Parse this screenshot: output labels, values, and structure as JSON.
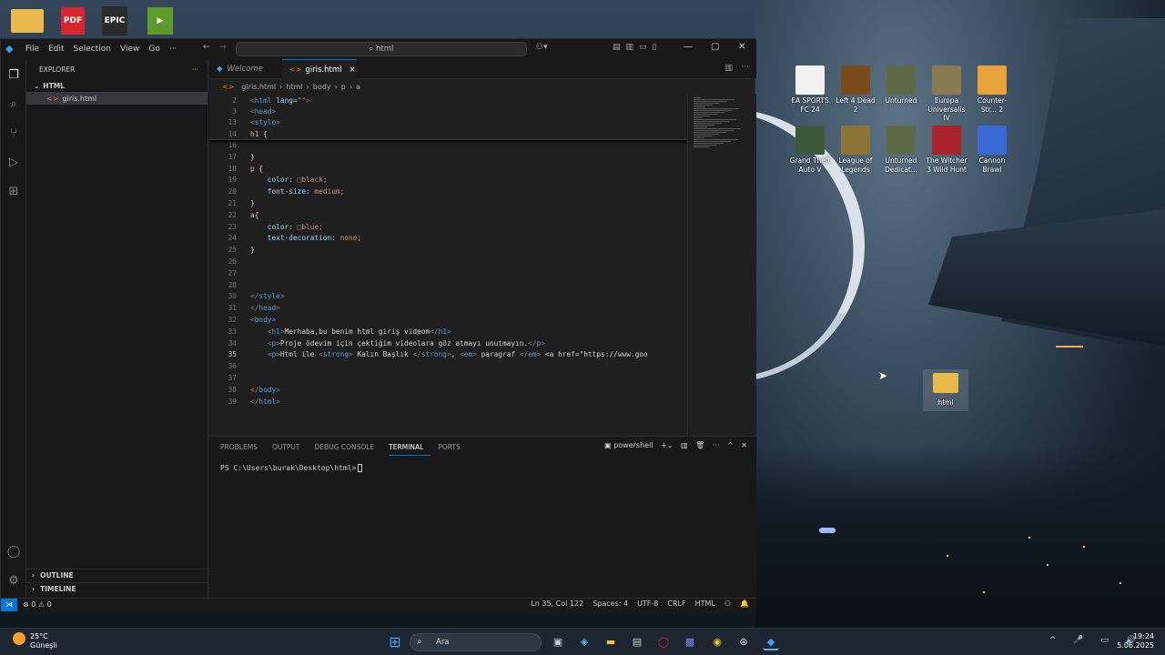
{
  "desktop_top_icons": [
    {
      "label": "",
      "glyph": "",
      "color": "#e9b949"
    },
    {
      "label": "PDF",
      "glyph": "PDF",
      "color": "#d7262e"
    },
    {
      "label": "EPIC",
      "glyph": "EPIC",
      "color": "#2a2a2a"
    },
    {
      "label": "",
      "glyph": "▶",
      "color": "#5f9b2a"
    }
  ],
  "window": {
    "menu": [
      "File",
      "Edit",
      "Selection",
      "View",
      "Go",
      "···"
    ],
    "search": "html",
    "controls": [
      "—",
      "▢",
      "✕"
    ]
  },
  "explorer": {
    "title": "EXPLORER",
    "more": "···",
    "folder": "HTML",
    "file": "giris.html",
    "outline": "OUTLINE",
    "timeline": "TIMELINE"
  },
  "tabs": [
    {
      "label": "Welcome",
      "active": false
    },
    {
      "label": "giris.html",
      "active": true,
      "close": "×"
    }
  ],
  "breadcrumb": [
    "giris.html",
    "html",
    "body",
    "p",
    "a"
  ],
  "sticky": [
    {
      "n": "2",
      "t": "<html lang=\"\">"
    },
    {
      "n": "3",
      "t": "<head>"
    },
    {
      "n": "13",
      "t": "<style>"
    },
    {
      "n": "14",
      "t": "h1 {"
    }
  ],
  "code": [
    {
      "n": "16",
      "t": ""
    },
    {
      "n": "17",
      "t": "}"
    },
    {
      "n": "18",
      "t": "p {"
    },
    {
      "n": "19",
      "t": "    color: □black;"
    },
    {
      "n": "20",
      "t": "    font-size: medium;"
    },
    {
      "n": "21",
      "t": "}"
    },
    {
      "n": "22",
      "t": "a{"
    },
    {
      "n": "23",
      "t": "    color: □blue;"
    },
    {
      "n": "24",
      "t": "    text-decoration: none;"
    },
    {
      "n": "25",
      "t": "}"
    },
    {
      "n": "26",
      "t": ""
    },
    {
      "n": "27",
      "t": ""
    },
    {
      "n": "28",
      "t": ""
    },
    {
      "n": "30",
      "t": "</style>"
    },
    {
      "n": "31",
      "t": "</head>"
    },
    {
      "n": "32",
      "t": "<body>"
    },
    {
      "n": "33",
      "t": "    <h1>Merhaba,bu benim html giriş videom</h1>"
    },
    {
      "n": "34",
      "t": "    <p>Proje ödevim için çektiğim videolara göz atmayı unutmayın.</p>"
    },
    {
      "n": "35",
      "t": "    <p>Html ile <strong> Kalın Başlık </strong>, <em> paragraf </em> <a href=\"https://www.goo"
    },
    {
      "n": "36",
      "t": ""
    },
    {
      "n": "37",
      "t": ""
    },
    {
      "n": "38",
      "t": "</body>"
    },
    {
      "n": "39",
      "t": "</html>"
    }
  ],
  "panel": {
    "tabs": [
      "PROBLEMS",
      "OUTPUT",
      "DEBUG CONSOLE",
      "TERMINAL",
      "PORTS"
    ],
    "active": "TERMINAL",
    "shell": "powershell",
    "prompt": "PS C:\\Users\\burak\\Desktop\\html>"
  },
  "status": {
    "errors": "⊗ 0 ⚠ 0",
    "position": "Ln 35, Col 122",
    "spaces": "Spaces: 4",
    "encoding": "UTF-8",
    "eol": "CRLF",
    "lang": "HTML"
  },
  "desktop_icons": [
    {
      "label": "EA SPORTS FC 24",
      "color": "#f2f2f2"
    },
    {
      "label": "Left 4 Dead 2",
      "color": "#7a4b1a"
    },
    {
      "label": "Unturned",
      "color": "#5c6a48"
    },
    {
      "label": "Europa Universalis IV",
      "color": "#8a7a52"
    },
    {
      "label": "Counter-Str... 2",
      "color": "#e8a23a"
    },
    {
      "label": "Grand Theft Auto V",
      "color": "#3a5a3a"
    },
    {
      "label": "League of Legends",
      "color": "#8c7434"
    },
    {
      "label": "Unturned Dedicat...",
      "color": "#5c6a48"
    },
    {
      "label": "The Witcher 3 Wild Hunt",
      "color": "#a8242a"
    },
    {
      "label": "Cannon Brawl",
      "color": "#3a6bd4"
    }
  ],
  "desktop_folder": "html",
  "taskbar": {
    "weather_temp": "25°C",
    "weather_desc": "Güneşli",
    "search": "Ara",
    "time": "19:24",
    "date": "5.06.2025"
  }
}
